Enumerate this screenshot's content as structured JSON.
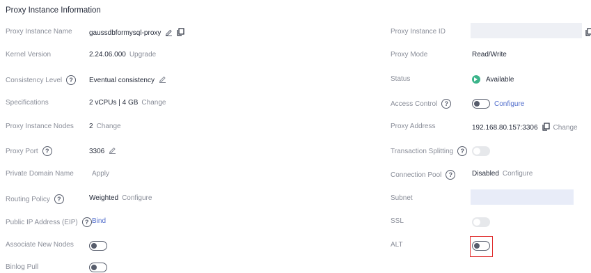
{
  "title": "Proxy Instance Information",
  "left": {
    "proxy_instance_name": {
      "label": "Proxy Instance Name",
      "value": "gaussdbformysql-proxy"
    },
    "kernel_version": {
      "label": "Kernel Version",
      "value": "2.24.06.000",
      "action": "Upgrade"
    },
    "consistency_level": {
      "label": "Consistency Level",
      "value": "Eventual consistency"
    },
    "specifications": {
      "label": "Specifications",
      "value": "2 vCPUs | 4 GB",
      "action": "Change"
    },
    "proxy_instance_nodes": {
      "label": "Proxy Instance Nodes",
      "value": "2",
      "action": "Change"
    },
    "proxy_port": {
      "label": "Proxy Port",
      "value": "3306"
    },
    "private_domain_name": {
      "label": "Private Domain Name",
      "action": "Apply"
    },
    "routing_policy": {
      "label": "Routing Policy",
      "value": "Weighted",
      "action": "Configure"
    },
    "public_ip": {
      "label": "Public IP Address (EIP)",
      "action": "Bind"
    },
    "associate_new_nodes": {
      "label": "Associate New Nodes",
      "enabled": false
    },
    "binlog_pull": {
      "label": "Binlog Pull",
      "enabled": false
    }
  },
  "right": {
    "proxy_instance_id": {
      "label": "Proxy Instance ID"
    },
    "proxy_mode": {
      "label": "Proxy Mode",
      "value": "Read/Write"
    },
    "status": {
      "label": "Status",
      "value": "Available"
    },
    "access_control": {
      "label": "Access Control",
      "action": "Configure",
      "enabled": false
    },
    "proxy_address": {
      "label": "Proxy Address",
      "value": "192.168.80.157:3306",
      "action": "Change"
    },
    "transaction_splitting": {
      "label": "Transaction Splitting",
      "enabled": false
    },
    "connection_pool": {
      "label": "Connection Pool",
      "value": "Disabled",
      "action": "Configure"
    },
    "subnet": {
      "label": "Subnet"
    },
    "ssl": {
      "label": "SSL",
      "enabled": false
    },
    "alt": {
      "label": "ALT",
      "enabled": false
    }
  },
  "help_glyph": "?",
  "colors": {
    "link": "#526ecc",
    "status_available": "#3bb48a",
    "highlight": "#e03030"
  }
}
